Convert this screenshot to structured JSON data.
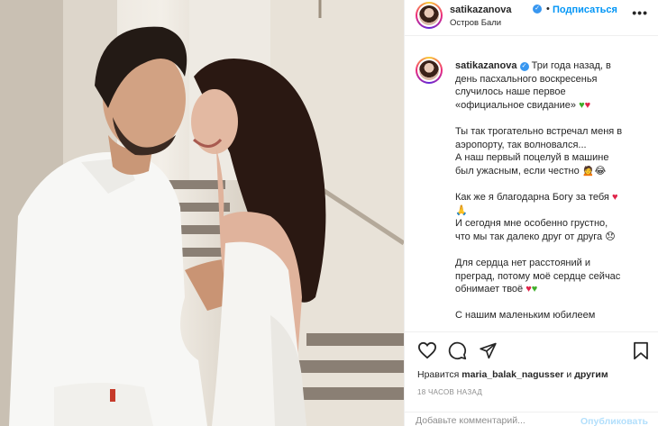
{
  "post": {
    "username": "satikazanova",
    "follow_label": "Подписаться",
    "separator": "•",
    "location": "Остров Бали",
    "more_label": "•••"
  },
  "caption": {
    "username": "satikazanova",
    "lines": [
      "Три года назад, в",
      "день пасхального воскресенья",
      "случилось наше первое",
      "«официальное свидание»",
      "",
      "Ты так трогательно встречал меня в",
      "аэропорту, так волновался...",
      "А наш первый поцелуй в машине",
      "был ужасным, если честно",
      "",
      "Как же я благодарна Богу за тебя",
      "",
      "И сегодня мне особенно грустно,",
      "что мы так далеко друг от друга",
      "",
      "Для сердца нет расстояний и",
      "преград, потому моё сердце сейчас",
      "обнимает твоё",
      "",
      "С нашим маленьким юбилеем"
    ]
  },
  "likes": {
    "prefix": "Нравится",
    "user": "maria_balak_nagusser",
    "conj": "и",
    "others": "другим"
  },
  "time_ago": "18 ЧАСОВ НАЗАД",
  "comment": {
    "placeholder": "Добавьте комментарий...",
    "publish_label": "Опубликовать"
  },
  "icons": {
    "like": "heart-outline-icon",
    "comment": "comment-bubble-icon",
    "share": "paper-plane-icon",
    "save": "bookmark-icon",
    "verified": "verified-badge-icon"
  },
  "colors": {
    "accent": "#0095f6",
    "verified": "#3897f0",
    "muted": "#8e8e8e",
    "red_heart": "#e0244a",
    "green_heart": "#3fae2a"
  }
}
